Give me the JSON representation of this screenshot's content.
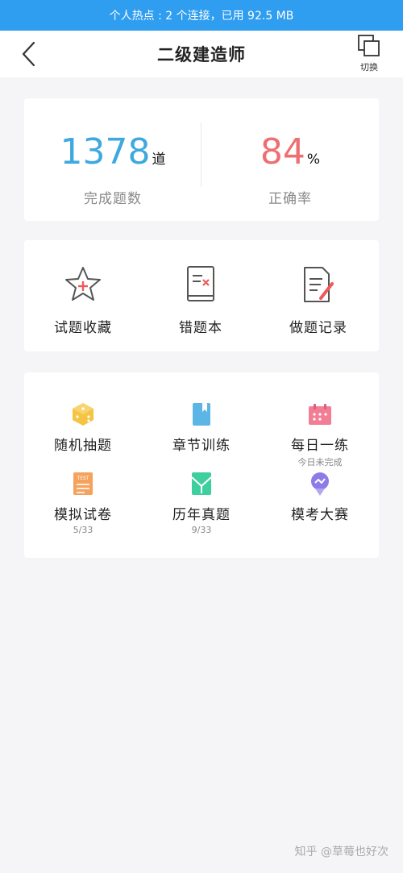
{
  "status_bar": {
    "text": "个人热点 : 2 个连接，已用 92.5 MB"
  },
  "nav": {
    "title": "二级建造师",
    "switch_label": "切换"
  },
  "stats": {
    "completed": {
      "value": "1378",
      "unit": "道",
      "label": "完成题数",
      "color": "#3ea8df"
    },
    "accuracy": {
      "value": "84",
      "unit": "%",
      "label": "正确率",
      "color": "#ee6f72"
    }
  },
  "tools": [
    {
      "label": "试题收藏",
      "icon": "star-plus-icon"
    },
    {
      "label": "错题本",
      "icon": "wrong-book-icon"
    },
    {
      "label": "做题记录",
      "icon": "record-edit-icon"
    }
  ],
  "practice": [
    {
      "label": "随机抽题",
      "sub": "",
      "icon": "dice-icon",
      "color": "#f6c443"
    },
    {
      "label": "章节训练",
      "sub": "",
      "icon": "bookmark-book-icon",
      "color": "#5bb6e6"
    },
    {
      "label": "每日一练",
      "sub": "今日未完成",
      "icon": "calendar-icon",
      "color": "#f27e96"
    },
    {
      "label": "模拟试卷",
      "sub": "5/33",
      "icon": "test-paper-icon",
      "color": "#f5a25d"
    },
    {
      "label": "历年真题",
      "sub": "9/33",
      "icon": "envelope-icon",
      "color": "#3ecf9f"
    },
    {
      "label": "模考大赛",
      "sub": "",
      "icon": "medal-icon",
      "color": "#8e7be8"
    }
  ],
  "watermark": "知乎 @草莓也好次"
}
